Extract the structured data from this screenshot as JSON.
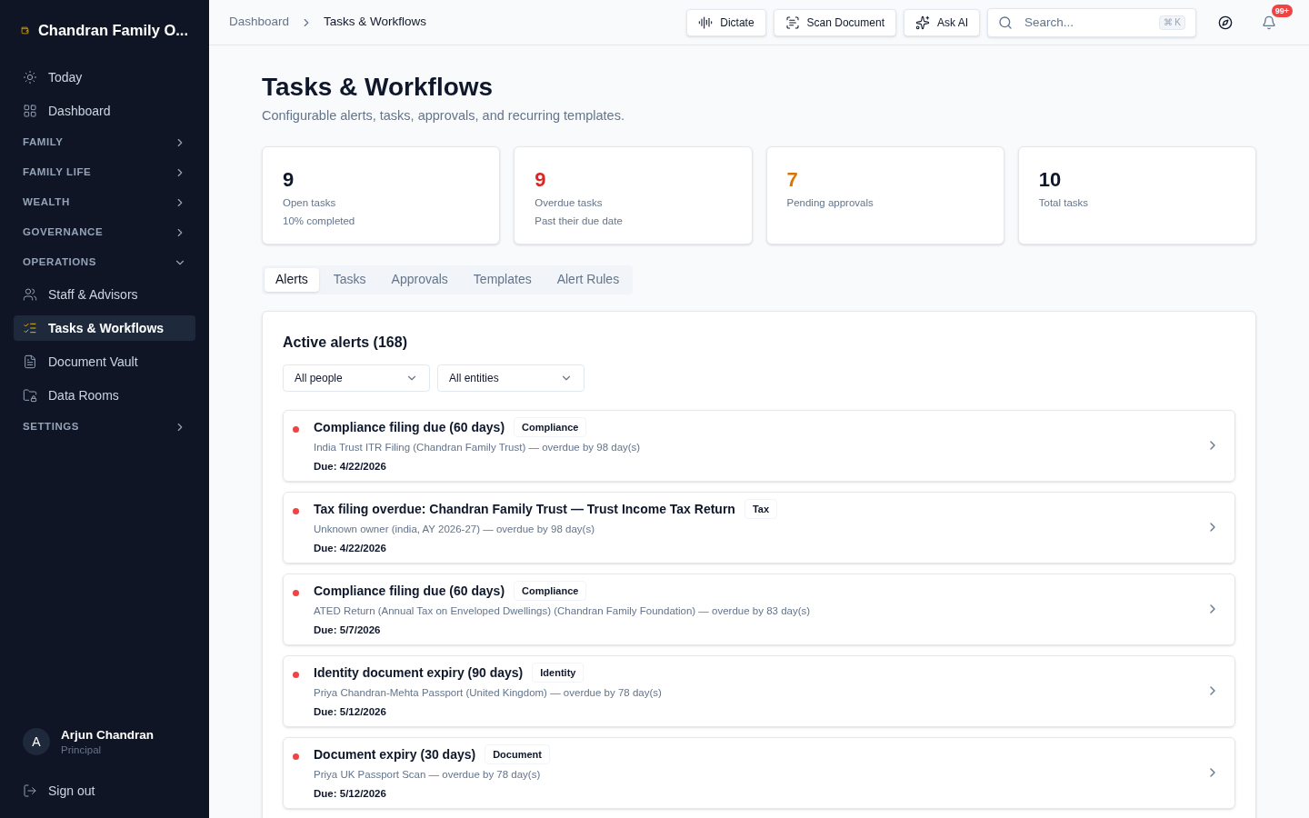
{
  "sidebar": {
    "brand": "Chandran Family O...",
    "items": [
      {
        "kind": "link",
        "label": "Today",
        "selected": false
      },
      {
        "kind": "link",
        "label": "Dashboard",
        "selected": false
      },
      {
        "kind": "section",
        "label": "FAMILY",
        "expanded": false
      },
      {
        "kind": "section",
        "label": "FAMILY LIFE",
        "expanded": false
      },
      {
        "kind": "section",
        "label": "WEALTH",
        "expanded": false
      },
      {
        "kind": "section",
        "label": "GOVERNANCE",
        "expanded": false
      },
      {
        "kind": "section",
        "label": "OPERATIONS",
        "expanded": true
      },
      {
        "kind": "link",
        "label": "Staff & Advisors",
        "selected": false
      },
      {
        "kind": "link",
        "label": "Tasks & Workflows",
        "selected": true
      },
      {
        "kind": "link",
        "label": "Document Vault",
        "selected": false
      },
      {
        "kind": "link",
        "label": "Data Rooms",
        "selected": false
      },
      {
        "kind": "section",
        "label": "SETTINGS",
        "expanded": false
      }
    ],
    "user": {
      "initial": "A",
      "name": "Arjun Chandran",
      "role": "Principal"
    },
    "sign_out": "Sign out"
  },
  "breadcrumbs": [
    "Dashboard",
    "Tasks & Workflows"
  ],
  "toolbar": {
    "buttons": [
      {
        "label": "Dictate"
      },
      {
        "label": "Scan Document"
      },
      {
        "label": "Ask AI"
      }
    ],
    "search": {
      "placeholder": "Search...",
      "shortcut": "⌘ K"
    },
    "notifications": "99+"
  },
  "page": {
    "title": "Tasks & Workflows",
    "subtitle": "Configurable alerts, tasks, approvals, and recurring templates."
  },
  "stats": [
    {
      "value": "9",
      "label": "Open tasks",
      "note": "10% completed",
      "color": "#0f172a"
    },
    {
      "value": "9",
      "label": "Overdue tasks",
      "note": "Past their due date",
      "color": "#dc2626"
    },
    {
      "value": "7",
      "label": "Pending approvals",
      "color": "#d97706"
    },
    {
      "value": "10",
      "label": "Total tasks",
      "color": "#0f172a"
    }
  ],
  "tabs": [
    {
      "label": "Alerts",
      "selected": true
    },
    {
      "label": "Tasks",
      "selected": false
    },
    {
      "label": "Approvals",
      "selected": false
    },
    {
      "label": "Templates",
      "selected": false
    },
    {
      "label": "Alert Rules",
      "selected": false
    }
  ],
  "alerts_panel": {
    "title": "Active alerts (168)",
    "filters": [
      "All people",
      "All entities"
    ],
    "alerts": [
      {
        "title": "Compliance filing due (60 days)",
        "tag": "Compliance",
        "detail": "India Trust ITR Filing (Chandran Family Trust) — overdue by 98 day(s)",
        "due": "Due: 4/22/2026",
        "color": "#ef4444"
      },
      {
        "title": "Tax filing overdue: Chandran Family Trust — Trust Income Tax Return",
        "tag": "Tax",
        "detail": "Unknown owner (india, AY 2026-27) — overdue by 98 day(s)",
        "due": "Due: 4/22/2026",
        "color": "#ef4444"
      },
      {
        "title": "Compliance filing due (60 days)",
        "tag": "Compliance",
        "detail": "ATED Return (Annual Tax on Enveloped Dwellings) (Chandran Family Foundation) — overdue by 83 day(s)",
        "due": "Due: 5/7/2026",
        "color": "#ef4444"
      },
      {
        "title": "Identity document expiry (90 days)",
        "tag": "Identity",
        "detail": "Priya Chandran-Mehta Passport (United Kingdom) — overdue by 78 day(s)",
        "due": "Due: 5/12/2026",
        "color": "#ef4444"
      },
      {
        "title": "Document expiry (30 days)",
        "tag": "Document",
        "detail": "Priya UK Passport Scan — overdue by 78 day(s)",
        "due": "Due: 5/12/2026",
        "color": "#ef4444"
      }
    ]
  }
}
